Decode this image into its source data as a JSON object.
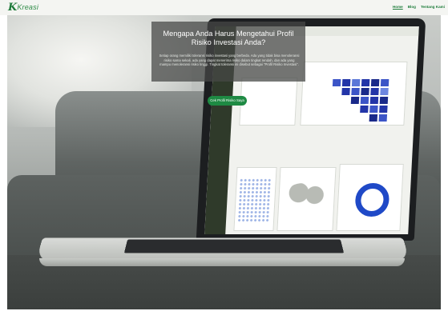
{
  "brand": {
    "logo_text": "Kreasi",
    "logo_mark": "K",
    "color": "#1e7a3a"
  },
  "nav": {
    "items": [
      {
        "label": "Home",
        "active": true
      },
      {
        "label": "Blog",
        "active": false
      },
      {
        "label": "Tentang Kami",
        "active": false
      }
    ]
  },
  "hero": {
    "title": "Mengapa Anda Harus Mengetahui Profil Risiko Investasi Anda?",
    "description": "Setiap orang memiliki toleransi risiko investasi yang berbeda. Ada yang tidak bisa menoleransi risiko sama sekali, ada yang dapat menerima risiko dalam tingkat rendah, dan ada yang mampu menoleransi risiko tinggi. Tingkat toleransi ini disebut sebagai \"Profil Risiko Investasi\".",
    "cta_label": "Cek Profil Risiko Saya",
    "cta_color": "#1e8a43"
  }
}
